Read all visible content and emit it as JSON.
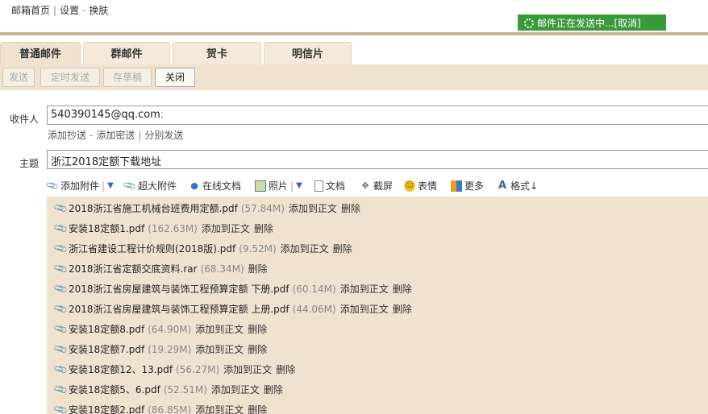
{
  "topnav": {
    "home": "邮箱首页",
    "settings": "设置",
    "skin": "换肤"
  },
  "status": {
    "text": "邮件正在发送中...",
    "cancel": "[取消]"
  },
  "tabs": [
    "普通邮件",
    "群邮件",
    "贺卡",
    "明信片"
  ],
  "toolbar": {
    "send": "发送",
    "timed_send": "定时发送",
    "draft": "存草稿",
    "close": "关闭"
  },
  "recipient": {
    "label": "收件人",
    "value": "540390145@qq.com",
    "separator": ";"
  },
  "recipient_links": {
    "cc": "添加抄送",
    "dash": "-",
    "bcc": "添加密送",
    "separate": "分别发送"
  },
  "subject": {
    "label": "主题",
    "value": "浙江2018定额下载地址"
  },
  "editor_toolbar": {
    "attach": "添加附件",
    "big_attach": "超大附件",
    "online_doc": "在线文档",
    "photo": "照片",
    "doc": "文档",
    "screenshot": "截屏",
    "emoji": "表情",
    "more": "更多",
    "format": "格式↓"
  },
  "attachments": [
    {
      "name": "2018浙江省施工机械台班费用定额.pdf",
      "size": "(57.84M)",
      "add": "添加到正文",
      "del": "删除"
    },
    {
      "name": "安装18定额1.pdf",
      "size": "(162.63M)",
      "add": "添加到正文",
      "del": "删除"
    },
    {
      "name": "浙江省建设工程计价规则(2018版).pdf",
      "size": "(9.52M)",
      "add": "添加到正文",
      "del": "删除"
    },
    {
      "name": "2018浙江省定额交底资料.rar",
      "size": "(68.34M)",
      "add": "",
      "del": "删除"
    },
    {
      "name": "2018浙江省房屋建筑与装饰工程预算定额 下册.pdf",
      "size": "(60.14M)",
      "add": "添加到正文",
      "del": "删除"
    },
    {
      "name": "2018浙江省房屋建筑与装饰工程预算定额 上册.pdf",
      "size": "(44.06M)",
      "add": "添加到正文",
      "del": "删除"
    },
    {
      "name": "安装18定额8.pdf",
      "size": "(64.90M)",
      "add": "添加到正文",
      "del": "删除"
    },
    {
      "name": "安装18定额7.pdf",
      "size": "(19.29M)",
      "add": "添加到正文",
      "del": "删除"
    },
    {
      "name": "安装18定额12、13.pdf",
      "size": "(56.27M)",
      "add": "添加到正文",
      "del": "删除"
    },
    {
      "name": "安装18定额5、6.pdf",
      "size": "(52.51M)",
      "add": "添加到正文",
      "del": "删除"
    },
    {
      "name": "安装18定额2.pdf",
      "size": "(86.85M)",
      "add": "添加到正文",
      "del": "删除"
    }
  ]
}
